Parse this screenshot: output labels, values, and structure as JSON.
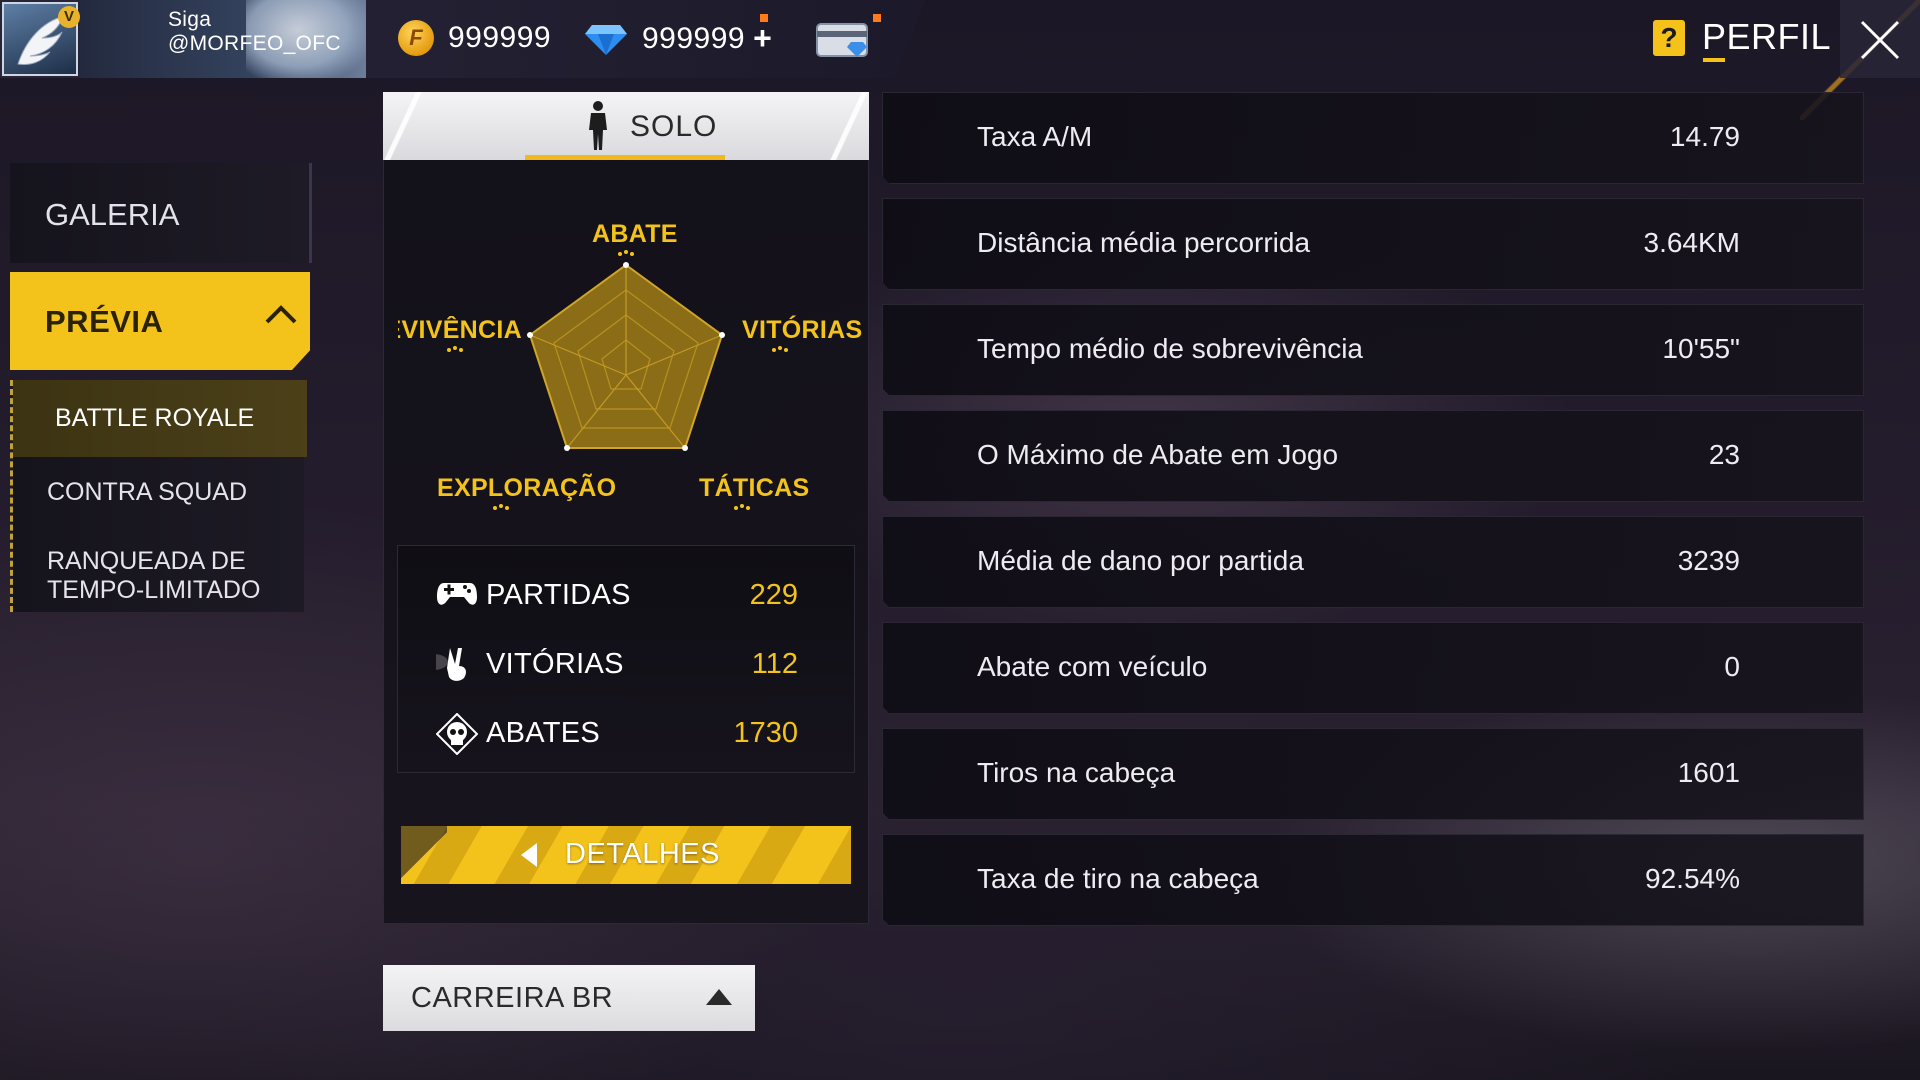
{
  "header": {
    "profile_name": "Siga @MORFEO_OFC",
    "avatar_badge": "V",
    "gold_value": "999999",
    "diamond_value": "999999",
    "diamond_plus": "+",
    "page_title": "PERFIL",
    "help_symbol": "?",
    "accent_color": "#f3c31b"
  },
  "sidebar": {
    "galeria": "GALERIA",
    "previa": "PRÉVIA",
    "sub_items": [
      "BATTLE ROYALE",
      "CONTRA SQUAD",
      "RANQUEADA DE\nTEMPO-LIMITADO"
    ]
  },
  "center": {
    "mode_tab": "SOLO",
    "radar": {
      "labels": [
        "ABATE",
        "VITÓRIAS",
        "SOBREVIVÊNCIA",
        "EXPLORAÇÃO",
        "TÁTICAS"
      ]
    },
    "stats": [
      {
        "label": "PARTIDAS",
        "value": "229",
        "icon": "gamepad-icon"
      },
      {
        "label": "VITÓRIAS",
        "value": "112",
        "icon": "victory-hand-icon"
      },
      {
        "label": "ABATES",
        "value": "1730",
        "icon": "skull-icon"
      }
    ],
    "details_button": "DETALHES",
    "career_select": "CARREIRA BR"
  },
  "stats_list": [
    {
      "label": "Taxa A/M",
      "value": "14.79"
    },
    {
      "label": "Distância média percorrida",
      "value": "3.64KM"
    },
    {
      "label": "Tempo médio de sobrevivência",
      "value": "10'55\""
    },
    {
      "label": "O Máximo de Abate em Jogo",
      "value": "23"
    },
    {
      "label": "Média de dano por partida",
      "value": "3239"
    },
    {
      "label": "Abate com veículo",
      "value": "0"
    },
    {
      "label": "Tiros na cabeça",
      "value": "1601"
    },
    {
      "label": "Taxa de tiro na cabeça",
      "value": "92.54%"
    }
  ]
}
